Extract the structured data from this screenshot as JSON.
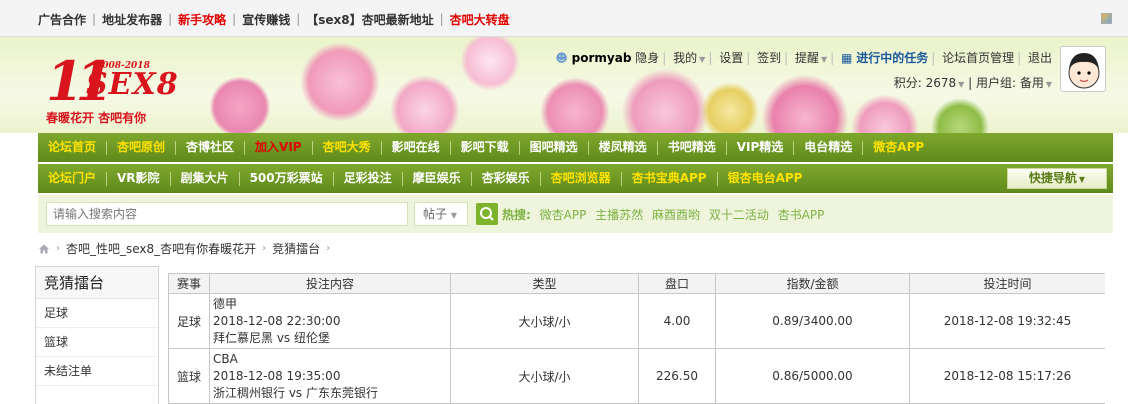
{
  "topbar": {
    "links": [
      {
        "label": "广告合作",
        "color": "#333333"
      },
      {
        "label": "地址发布器",
        "color": "#333333"
      },
      {
        "label": "新手攻略",
        "color": "#e00000"
      },
      {
        "label": "宣传赚钱",
        "color": "#333333"
      },
      {
        "label": "【sex8】杏吧最新地址",
        "color": "#333333"
      },
      {
        "label": "杏吧大转盘",
        "color": "#e00000"
      }
    ]
  },
  "logo": {
    "number": "11",
    "brand": "SEX8",
    "years": "2008-2018",
    "slogan": "春暖花开 杏吧有你"
  },
  "user": {
    "name": "pormyab",
    "links": [
      "隐身",
      "我的",
      "设置",
      "签到",
      "提醒"
    ],
    "task": "进行中的任务",
    "admin": "论坛首页管理",
    "logout": "退出",
    "points": "积分: 2678",
    "group": "用户组: 备用"
  },
  "nav1": [
    {
      "label": "论坛首页",
      "color": "#ffe200"
    },
    {
      "label": "杏吧原创",
      "color": "#ffe200"
    },
    {
      "label": "杏博社区",
      "color": "#ffffff"
    },
    {
      "label": "加入VIP",
      "color": "#e00000"
    },
    {
      "label": "杏吧大秀",
      "color": "#ffe200"
    },
    {
      "label": "影吧在线",
      "color": "#ffffff"
    },
    {
      "label": "影吧下载",
      "color": "#ffffff"
    },
    {
      "label": "图吧精选",
      "color": "#ffffff"
    },
    {
      "label": "楼凤精选",
      "color": "#ffffff"
    },
    {
      "label": "书吧精选",
      "color": "#ffffff"
    },
    {
      "label": "VIP精选",
      "color": "#ffffff"
    },
    {
      "label": "电台精选",
      "color": "#ffffff"
    },
    {
      "label": "微杏APP",
      "color": "#ffe200"
    }
  ],
  "nav2": [
    {
      "label": "论坛门户",
      "color": "#ffe200"
    },
    {
      "label": "VR影院",
      "color": "#ffffff"
    },
    {
      "label": "剧集大片",
      "color": "#ffffff"
    },
    {
      "label": "500万彩票站",
      "color": "#ffffff"
    },
    {
      "label": "足彩投注",
      "color": "#ffffff"
    },
    {
      "label": "摩臣娱乐",
      "color": "#ffffff"
    },
    {
      "label": "杏彩娱乐",
      "color": "#ffffff"
    },
    {
      "label": "杏吧浏览器",
      "color": "#ffe200"
    },
    {
      "label": "杏书宝典APP",
      "color": "#ffe200"
    },
    {
      "label": "银杏电台APP",
      "color": "#ffe200"
    }
  ],
  "quicknav": "快捷导航",
  "search": {
    "placeholder": "请输入搜索内容",
    "type": "帖子",
    "hot_label": "热搜:",
    "hot": [
      "微杏APP",
      "主播苏然",
      "麻酉酉哟",
      "双十二活动",
      "杏书APP"
    ]
  },
  "breadcrumb": [
    "杏吧_性吧_sex8_杏吧有你春暖花开",
    "竞猜擂台"
  ],
  "sidebar": {
    "title": "竞猜擂台",
    "items": [
      "足球",
      "篮球",
      "未结注单"
    ]
  },
  "table": {
    "headers": [
      "赛事",
      "投注内容",
      "类型",
      "盘口",
      "指数/金额",
      "投注时间"
    ],
    "rows": [
      {
        "sport": "足球",
        "league": "德甲",
        "time": "2018-12-08 22:30:00",
        "match": "拜仁慕尼黑 vs 纽伦堡",
        "type": "大小球/小",
        "line": "4.00",
        "odds": "0.89/3400.00",
        "bet_time": "2018-12-08 19:32:45"
      },
      {
        "sport": "篮球",
        "league": "CBA",
        "time": "2018-12-08 19:35:00",
        "match": "浙江稠州银行 vs 广东东莞银行",
        "type": "大小球/小",
        "line": "226.50",
        "odds": "0.86/5000.00",
        "bet_time": "2018-12-08 15:17:26"
      }
    ]
  }
}
